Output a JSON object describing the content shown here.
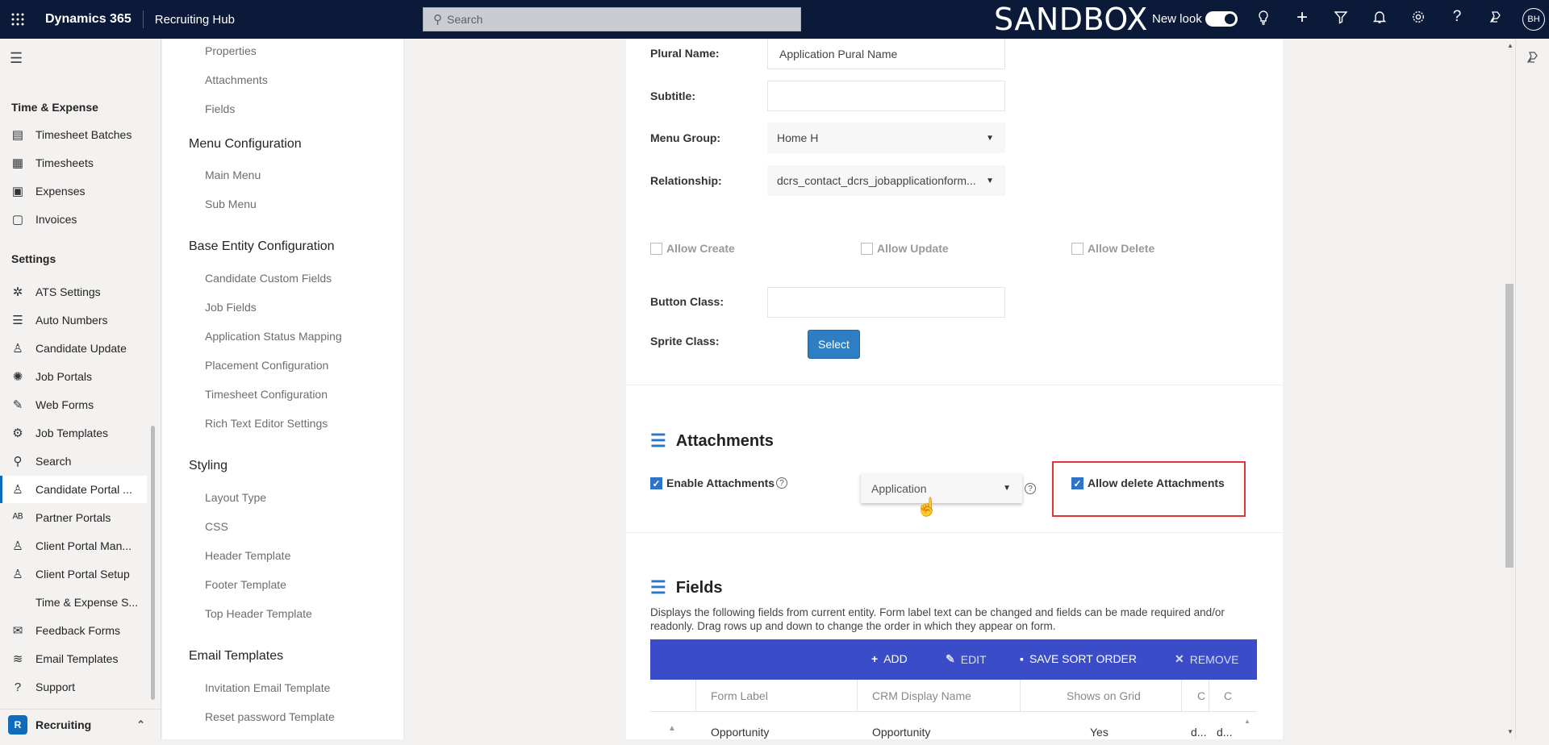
{
  "topbar": {
    "brand": "Dynamics 365",
    "app": "Recruiting Hub",
    "search_placeholder": "Search",
    "environment": "SANDBOX",
    "new_look_label": "New look",
    "avatar_initials": "BH",
    "icons": [
      "waffle-icon",
      "lightbulb-icon",
      "plus-icon",
      "filter-icon",
      "bell-icon",
      "gear-icon",
      "help-icon",
      "copilot-icon"
    ]
  },
  "leftnav": {
    "sections": [
      {
        "title": "Time & Expense",
        "items": [
          {
            "label": "Timesheet Batches",
            "icon": "▤"
          },
          {
            "label": "Timesheets",
            "icon": "▦"
          },
          {
            "label": "Expenses",
            "icon": "▣"
          },
          {
            "label": "Invoices",
            "icon": "▢"
          }
        ]
      },
      {
        "title": "Settings",
        "items": [
          {
            "label": "ATS Settings",
            "icon": "✲"
          },
          {
            "label": "Auto Numbers",
            "icon": "☰"
          },
          {
            "label": "Candidate Update",
            "icon": "♙"
          },
          {
            "label": "Job Portals",
            "icon": "✺"
          },
          {
            "label": "Web Forms",
            "icon": "✎"
          },
          {
            "label": "Job Templates",
            "icon": "⚙"
          },
          {
            "label": "Search",
            "icon": "⚲"
          },
          {
            "label": "Candidate Portal ...",
            "icon": "♙"
          },
          {
            "label": "Partner Portals",
            "icon": "ᴬᴮ"
          },
          {
            "label": "Client Portal Man...",
            "icon": "♙"
          },
          {
            "label": "Client Portal Setup",
            "icon": "♙"
          },
          {
            "label": "Time & Expense S...",
            "icon": ""
          },
          {
            "label": "Feedback Forms",
            "icon": "✉"
          },
          {
            "label": "Email Templates",
            "icon": "≋"
          },
          {
            "label": "Support",
            "icon": "?"
          }
        ]
      }
    ],
    "active_item": "Candidate Portal ...",
    "area_switcher": {
      "letter": "R",
      "label": "Recruiting"
    }
  },
  "settings_menu": {
    "items_top": [
      "Properties",
      "Attachments",
      "Fields"
    ],
    "groups": [
      {
        "title": "Menu Configuration",
        "items": [
          "Main Menu",
          "Sub Menu"
        ]
      },
      {
        "title": "Base Entity Configuration",
        "items": [
          "Candidate Custom Fields",
          "Job Fields",
          "Application Status Mapping",
          "Placement Configuration",
          "Timesheet Configuration",
          "Rich Text Editor Settings"
        ]
      },
      {
        "title": "Styling",
        "items": [
          "Layout Type",
          "CSS",
          "Header Template",
          "Footer Template",
          "Top Header Template"
        ]
      },
      {
        "title": "Email Templates",
        "items": [
          "Invitation Email Template",
          "Reset password Template"
        ]
      }
    ]
  },
  "form": {
    "plural_name": {
      "label": "Plural Name:",
      "value": "Application Pural Name"
    },
    "subtitle": {
      "label": "Subtitle:",
      "value": ""
    },
    "menu_group": {
      "label": "Menu Group:",
      "value": "Home H"
    },
    "relationship": {
      "label": "Relationship:",
      "value": "dcrs_contact_dcrs_jobapplicationform..."
    },
    "permissions": [
      {
        "label": "Allow Create",
        "checked": false
      },
      {
        "label": "Allow Update",
        "checked": false
      },
      {
        "label": "Allow Delete",
        "checked": false
      }
    ],
    "button_class": {
      "label": "Button Class:",
      "value": ""
    },
    "sprite_class": {
      "label": "Sprite Class:",
      "button": "Select"
    },
    "attachments": {
      "title": "Attachments",
      "enable_label": "Enable Attachments",
      "enable_checked": true,
      "entity_value": "Application",
      "allow_delete_label": "Allow delete Attachments",
      "allow_delete_checked": true
    },
    "fields": {
      "title": "Fields",
      "description": "Displays the following fields from current entity. Form label text can be changed and fields can be made required and/or readonly. Drag rows up and down to change the order in which they appear on form.",
      "toolbar": {
        "add": "ADD",
        "edit": "EDIT",
        "save_sort": "SAVE SORT ORDER",
        "remove": "REMOVE"
      },
      "columns": [
        "Form Label",
        "CRM Display Name",
        "Shows on Grid",
        "C",
        "C"
      ],
      "rows": [
        {
          "form_label": "Opportunity",
          "crm_name": "Opportunity",
          "shows_on_grid": "Yes",
          "c1": "d...",
          "c2": "d..."
        }
      ]
    }
  }
}
